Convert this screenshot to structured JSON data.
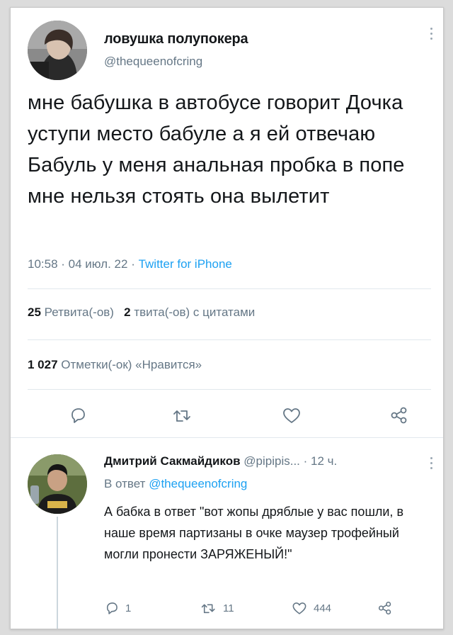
{
  "tweet": {
    "display_name": "ловушка полупокера",
    "handle": "@thequeenofcring",
    "text": "мне бабушка в автобусе говорит Дочка уступи место бабуле а я ей отвечаю Бабуль у меня анальная пробка в попе мне нельзя стоять она вылетит",
    "time": "10:58",
    "date": "04 июл. 22",
    "source": "Twitter for iPhone",
    "retweets_count": "25",
    "retweets_label": "Ретвита(-ов)",
    "quotes_count": "2",
    "quotes_label": "твита(-ов) с цитатами",
    "likes_count": "1 027",
    "likes_label": "Отметки(-ок) «Нравится»"
  },
  "reply": {
    "display_name": "Дмитрий Сакмайдиков",
    "handle": "@pipipis...",
    "time_ago": "12 ч.",
    "in_reply_prefix": "В ответ",
    "in_reply_mention": "@thequeenofcring",
    "text": "А бабка в ответ \"вот жопы дряблые у вас пошли, в наше время партизаны в очке маузер трофейный могли пронести ЗАРЯЖЕНЫЙ!\"",
    "reply_count": "1",
    "retweet_count": "11",
    "like_count": "444"
  },
  "colors": {
    "accent": "#1da1f2",
    "secondary_text": "#657786",
    "primary_text": "#14171a"
  }
}
